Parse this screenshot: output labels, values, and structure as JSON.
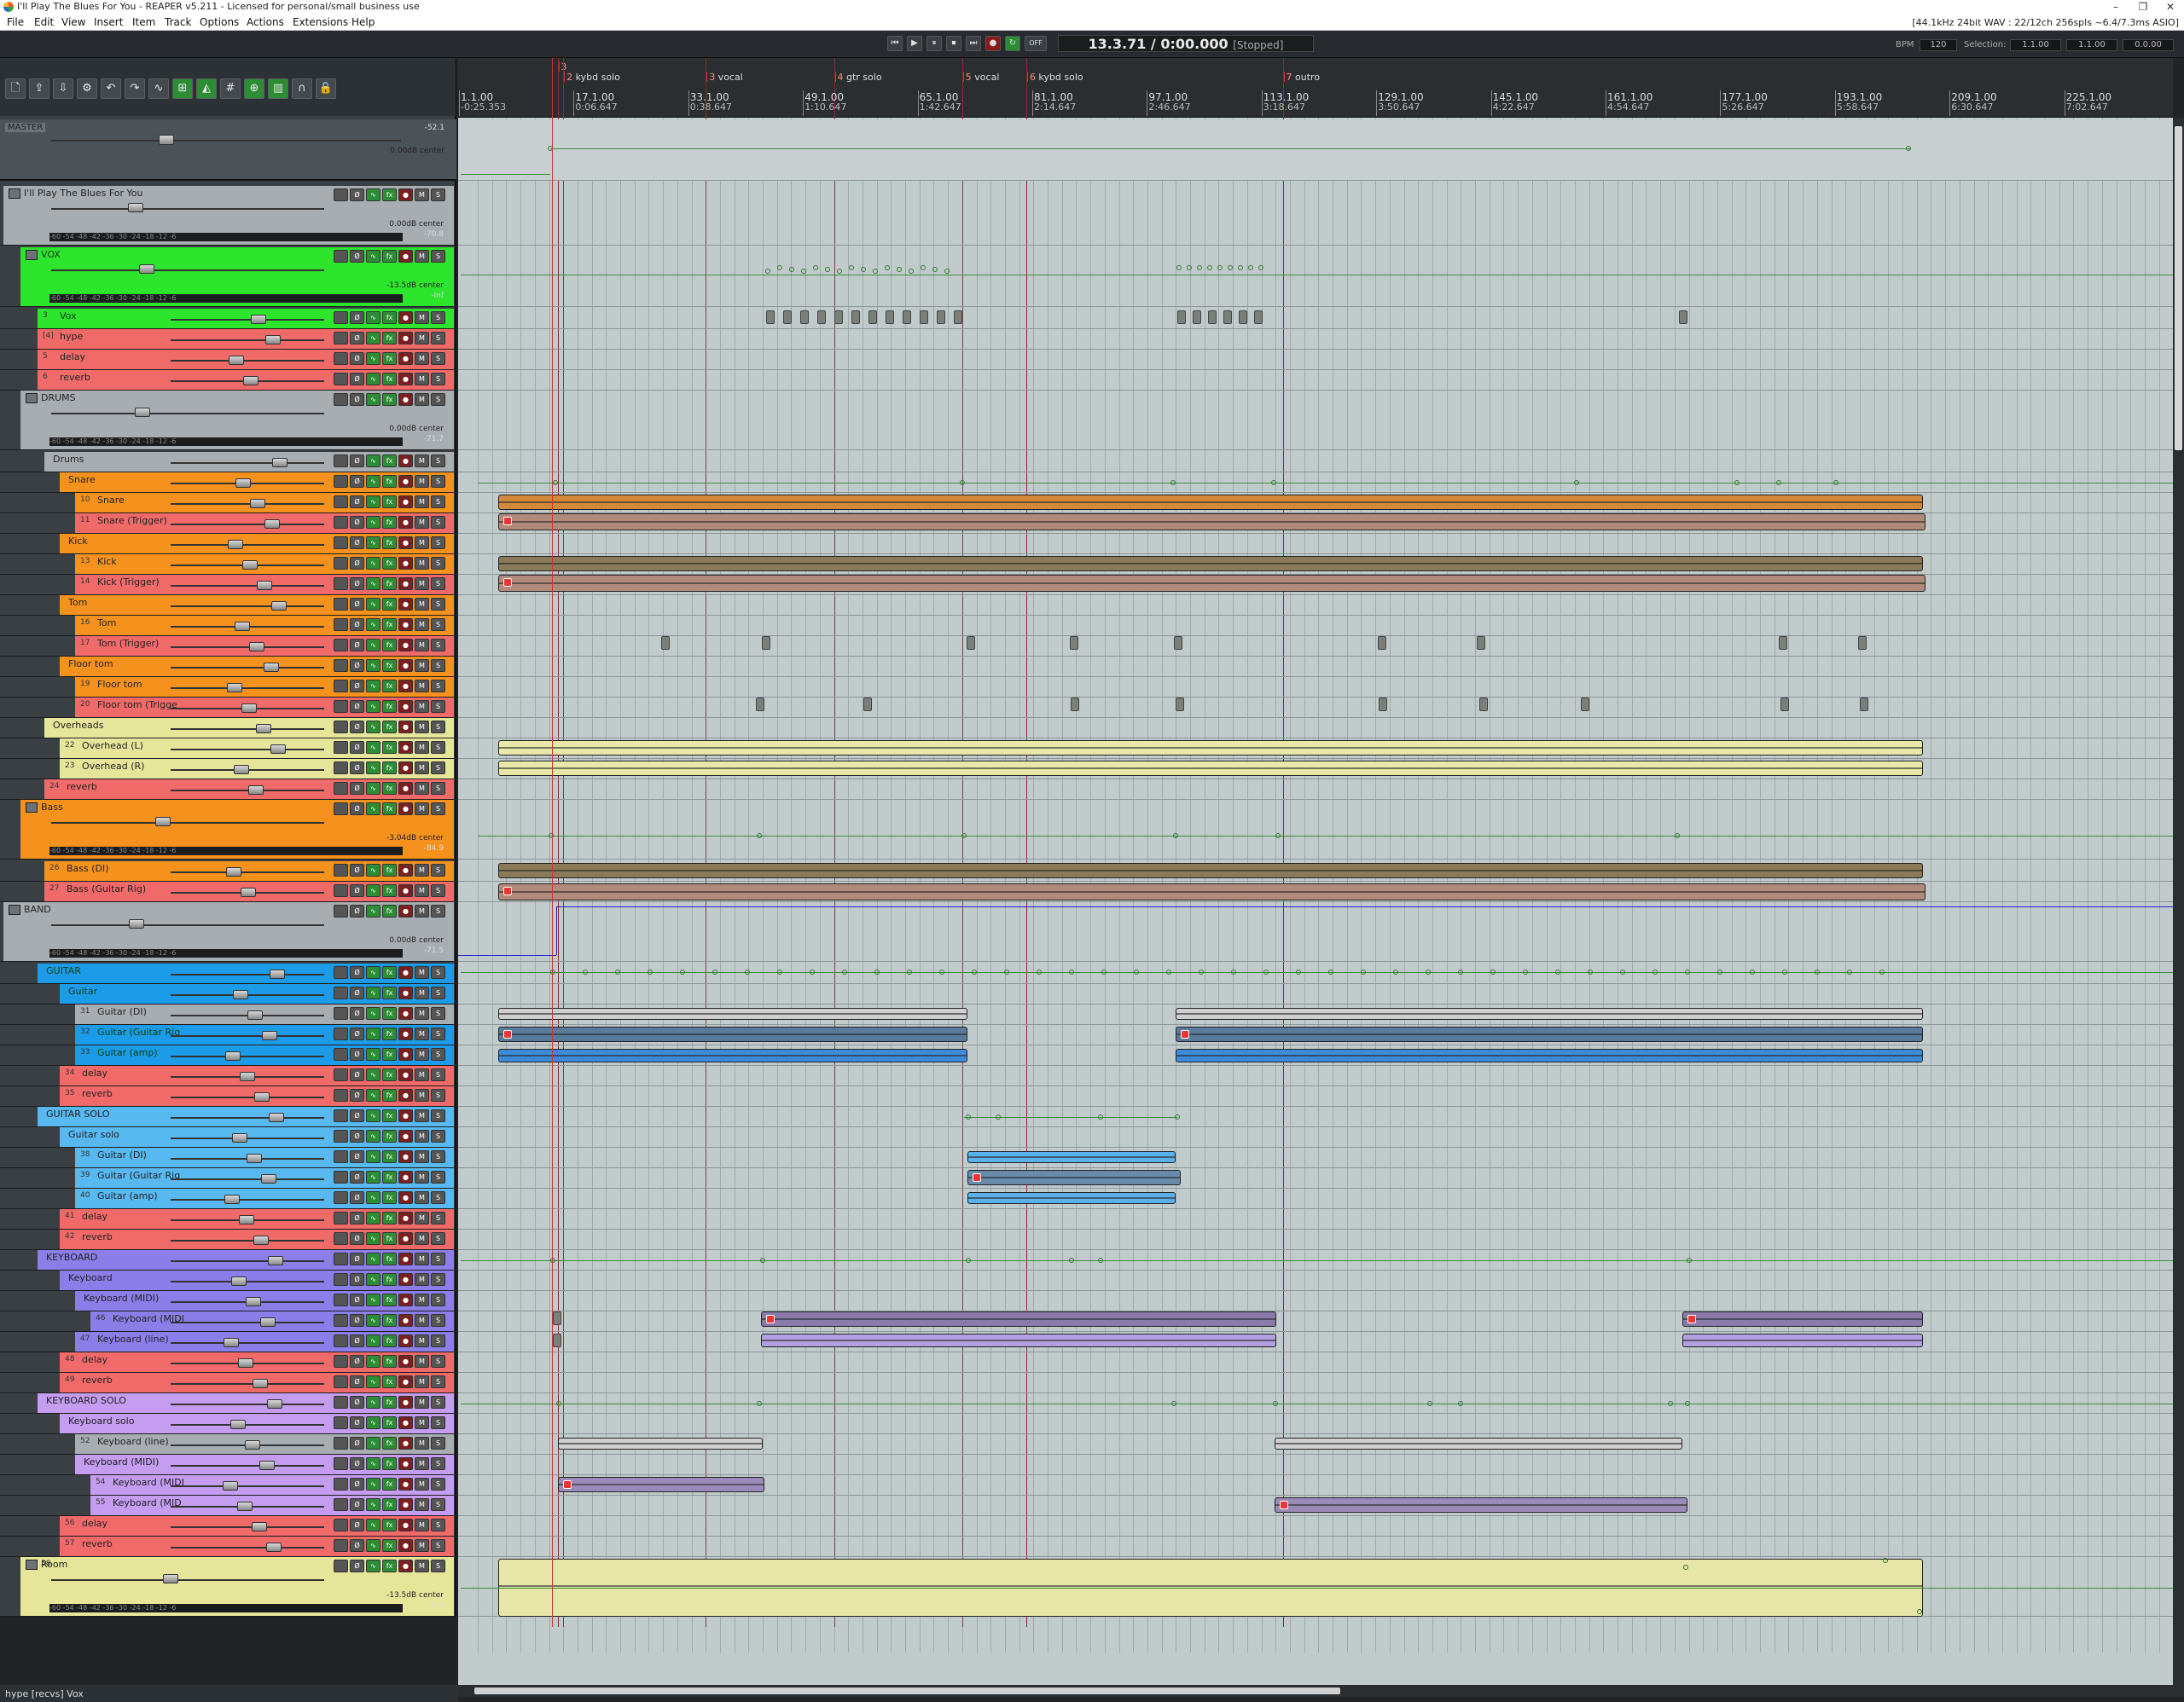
{
  "window": {
    "title": "I'll Play The Blues For You - REAPER v5.211 - Licensed for personal/small business use"
  },
  "menu": [
    "File",
    "Edit",
    "View",
    "Insert",
    "Item",
    "Track",
    "Options",
    "Actions",
    "Extensions",
    "Help"
  ],
  "audio_status": "[44.1kHz 24bit WAV : 22/12ch 256spls ~6.4/7.3ms ASIO]",
  "transport": {
    "position": "13.3.71 / 0:00.000",
    "state": "[Stopped]",
    "off_label": "OFF",
    "bpm_label": "BPM",
    "bpm": "120",
    "selection_label": "Selection:",
    "sel_start": "1.1.00",
    "sel_end": "1.1.00",
    "sel_len": "0.0.00"
  },
  "markers": [
    {
      "id": "3",
      "label": ""
    },
    {
      "id": "2",
      "label": "kybd solo"
    },
    {
      "id": "3",
      "label": "vocal"
    },
    {
      "id": "4",
      "label": "gtr solo"
    },
    {
      "id": "5",
      "label": "vocal"
    },
    {
      "id": "6",
      "label": "kybd solo"
    },
    {
      "id": "7",
      "label": "outro"
    }
  ],
  "bars": [
    {
      "bar": "1.1.00",
      "time": "-0:25.353"
    },
    {
      "bar": "17.1.00",
      "time": "0:06.647"
    },
    {
      "bar": "33.1.00",
      "time": "0:38.647"
    },
    {
      "bar": "49.1.00",
      "time": "1:10.647"
    },
    {
      "bar": "65.1.00",
      "time": "1:42.647"
    },
    {
      "bar": "81.1.00",
      "time": "2:14.647"
    },
    {
      "bar": "97.1.00",
      "time": "2:46.647"
    },
    {
      "bar": "113.1.00",
      "time": "3:18.647"
    },
    {
      "bar": "129.1.00",
      "time": "3:50.647"
    },
    {
      "bar": "145.1.00",
      "time": "4:22.647"
    },
    {
      "bar": "161.1.00",
      "time": "4:54.647"
    },
    {
      "bar": "177.1.00",
      "time": "5:26.647"
    },
    {
      "bar": "193.1.00",
      "time": "5:58.647"
    },
    {
      "bar": "209.1.00",
      "time": "6:30.647"
    },
    {
      "bar": "225.1.00",
      "time": "7:02.647"
    }
  ],
  "master": {
    "label": "MASTER",
    "peak": "-52.1",
    "vol": "0.00dB center"
  },
  "meter_scale": "-60 -54 -48 -42 -36 -30 -24 -18 -12 -6",
  "tracks": [
    {
      "num": "",
      "name": "I'll Play The Blues For You",
      "color": "#a8adb2",
      "folder": true,
      "vol": "0.00dB center",
      "peak": "-70.8"
    },
    {
      "num": "",
      "name": "VOX",
      "color": "#2ee52e",
      "folder": true,
      "vol": "-13.5dB center",
      "peak": "-inf"
    },
    {
      "num": "3",
      "name": "Vox",
      "color": "#2ee52e"
    },
    {
      "num": "[4]",
      "name": "hype",
      "color": "#f06a6a"
    },
    {
      "num": "5",
      "name": "delay",
      "color": "#f06a6a"
    },
    {
      "num": "6",
      "name": "reverb",
      "color": "#f06a6a"
    },
    {
      "num": "",
      "name": "DRUMS",
      "color": "#a8adb2",
      "folder": true,
      "vol": "0.00dB center",
      "peak": "-71.7"
    },
    {
      "num": "",
      "name": "Drums",
      "color": "#a8adb2"
    },
    {
      "num": "",
      "name": "Snare",
      "color": "#f5921e"
    },
    {
      "num": "10",
      "name": "Snare",
      "color": "#f5921e"
    },
    {
      "num": "11",
      "name": "Snare (Trigger)",
      "color": "#f06a6a"
    },
    {
      "num": "",
      "name": "Kick",
      "color": "#f5921e"
    },
    {
      "num": "13",
      "name": "Kick",
      "color": "#f5921e"
    },
    {
      "num": "14",
      "name": "Kick (Trigger)",
      "color": "#f06a6a"
    },
    {
      "num": "",
      "name": "Tom",
      "color": "#f5921e"
    },
    {
      "num": "16",
      "name": "Tom",
      "color": "#f5921e"
    },
    {
      "num": "17",
      "name": "Tom (Trigger)",
      "color": "#f06a6a"
    },
    {
      "num": "",
      "name": "Floor tom",
      "color": "#f5921e"
    },
    {
      "num": "19",
      "name": "Floor tom",
      "color": "#f5921e"
    },
    {
      "num": "20",
      "name": "Floor tom (Trigge",
      "color": "#f06a6a"
    },
    {
      "num": "",
      "name": "Overheads",
      "color": "#e6e69a"
    },
    {
      "num": "22",
      "name": "Overhead (L)",
      "color": "#e6e69a"
    },
    {
      "num": "23",
      "name": "Overhead (R)",
      "color": "#e6e69a"
    },
    {
      "num": "24",
      "name": "reverb",
      "color": "#f06a6a"
    },
    {
      "num": "",
      "name": "Bass",
      "color": "#f5921e",
      "folder": true,
      "vol": "-3.04dB center",
      "peak": "-84.9"
    },
    {
      "num": "26",
      "name": "Bass (DI)",
      "color": "#f5921e"
    },
    {
      "num": "27",
      "name": "Bass (Guitar Rig)",
      "color": "#f06a6a"
    },
    {
      "num": "",
      "name": "BAND",
      "color": "#a8adb2",
      "folder": true,
      "vol": "0.00dB center",
      "peak": "-71.5"
    },
    {
      "num": "",
      "name": "GUITAR",
      "color": "#1c9ce8"
    },
    {
      "num": "",
      "name": "Guitar",
      "color": "#1c9ce8"
    },
    {
      "num": "31",
      "name": "Guitar (DI)",
      "color": "#a8adb2"
    },
    {
      "num": "32",
      "name": "Guitar (Guitar Rig",
      "color": "#1c9ce8"
    },
    {
      "num": "33",
      "name": "Guitar (amp)",
      "color": "#1c9ce8"
    },
    {
      "num": "34",
      "name": "delay",
      "color": "#f06a6a"
    },
    {
      "num": "35",
      "name": "reverb",
      "color": "#f06a6a"
    },
    {
      "num": "",
      "name": "GUITAR SOLO",
      "color": "#58b8f0"
    },
    {
      "num": "",
      "name": "Guitar solo",
      "color": "#58b8f0"
    },
    {
      "num": "38",
      "name": "Guitar (DI)",
      "color": "#58b8f0"
    },
    {
      "num": "39",
      "name": "Guitar (Guitar Rig",
      "color": "#58b8f0"
    },
    {
      "num": "40",
      "name": "Guitar (amp)",
      "color": "#58b8f0"
    },
    {
      "num": "41",
      "name": "delay",
      "color": "#f06a6a"
    },
    {
      "num": "42",
      "name": "reverb",
      "color": "#f06a6a"
    },
    {
      "num": "",
      "name": "KEYBOARD",
      "color": "#8c7ee8"
    },
    {
      "num": "",
      "name": "Keyboard",
      "color": "#8c7ee8"
    },
    {
      "num": "",
      "name": "Keyboard (MIDI)",
      "color": "#8c7ee8"
    },
    {
      "num": "46",
      "name": "Keyboard (MIDI",
      "color": "#8c7ee8"
    },
    {
      "num": "47",
      "name": "Keyboard (line)",
      "color": "#8c7ee8"
    },
    {
      "num": "48",
      "name": "delay",
      "color": "#f06a6a"
    },
    {
      "num": "49",
      "name": "reverb",
      "color": "#f06a6a"
    },
    {
      "num": "",
      "name": "KEYBOARD SOLO",
      "color": "#c49cf0"
    },
    {
      "num": "",
      "name": "Keyboard solo",
      "color": "#c49cf0"
    },
    {
      "num": "52",
      "name": "Keyboard (line)",
      "color": "#a8adb2"
    },
    {
      "num": "",
      "name": "Keyboard (MIDI)",
      "color": "#c49cf0"
    },
    {
      "num": "54",
      "name": "Keyboard (MIDI",
      "color": "#c49cf0"
    },
    {
      "num": "55",
      "name": "Keyboard (MID",
      "color": "#c49cf0"
    },
    {
      "num": "56",
      "name": "delay",
      "color": "#f06a6a"
    },
    {
      "num": "57",
      "name": "reverb",
      "color": "#f06a6a"
    },
    {
      "num": "58",
      "name": "Room",
      "color": "#e6e69a",
      "folder": true,
      "vol": "-13.5dB center",
      "peak": "-inf"
    }
  ],
  "statusbar": "hype [recvs] Vox"
}
